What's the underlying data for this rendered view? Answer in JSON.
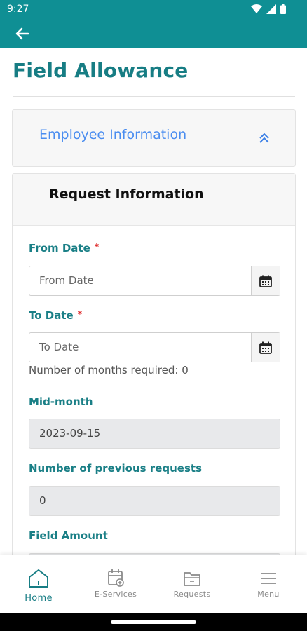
{
  "status_bar": {
    "time": "9:27"
  },
  "page": {
    "title": "Field Allowance"
  },
  "employee_section": {
    "label": "Employee Information"
  },
  "request_section": {
    "title": "Request Information"
  },
  "form": {
    "required_mark": "*",
    "from_date": {
      "label": "From Date",
      "placeholder": "From Date"
    },
    "to_date": {
      "label": "To Date",
      "placeholder": "To Date",
      "help": "Number of months required: 0"
    },
    "mid_month": {
      "label": "Mid-month",
      "value": "2023-09-15"
    },
    "previous_requests": {
      "label": "Number of previous requests",
      "value": "0"
    },
    "field_amount": {
      "label": "Field Amount"
    }
  },
  "bottom_nav": [
    {
      "label": "Home",
      "icon": "home-icon",
      "active": true
    },
    {
      "label": "E-Services",
      "icon": "calendar-plus-icon",
      "active": false
    },
    {
      "label": "Requests",
      "icon": "folder-icon",
      "active": false
    },
    {
      "label": "Menu",
      "icon": "hamburger-menu-icon",
      "active": false
    }
  ],
  "colors": {
    "primary": "#0f8f94",
    "title": "#177d84",
    "link": "#4a8df0",
    "required": "#dd2222"
  }
}
